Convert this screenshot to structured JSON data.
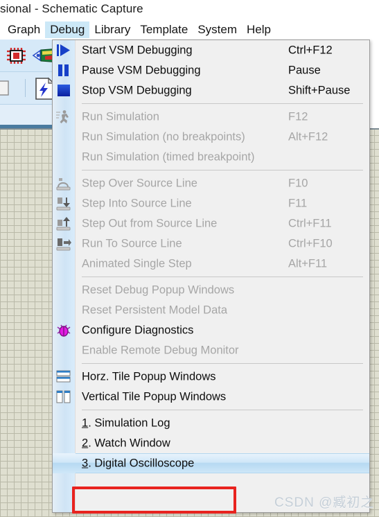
{
  "window": {
    "title": "sional - Schematic Capture"
  },
  "menubar": {
    "items": [
      {
        "label": "Graph",
        "active": false
      },
      {
        "label": "Debug",
        "active": true
      },
      {
        "label": "Library",
        "active": false
      },
      {
        "label": "Template",
        "active": false
      },
      {
        "label": "System",
        "active": false
      },
      {
        "label": "Help",
        "active": false
      }
    ]
  },
  "toolbar": {
    "icons": [
      {
        "name": "chip-icon"
      },
      {
        "name": "probe-icon"
      },
      {
        "name": "partial-icon"
      },
      {
        "name": "netlist-icon"
      }
    ]
  },
  "menu": {
    "name": "debug-menu",
    "items": [
      {
        "type": "item",
        "label": "Start VSM Debugging",
        "accel": "Ctrl+F12",
        "disabled": false,
        "icon": "play-icon",
        "mnemonic": ""
      },
      {
        "type": "item",
        "label": "Pause VSM Debugging",
        "accel": "Pause",
        "disabled": false,
        "icon": "pause-icon",
        "mnemonic": ""
      },
      {
        "type": "item",
        "label": "Stop VSM Debugging",
        "accel": "Shift+Pause",
        "disabled": false,
        "icon": "stop-icon",
        "mnemonic": ""
      },
      {
        "type": "separator"
      },
      {
        "type": "item",
        "label": "Run Simulation",
        "accel": "F12",
        "disabled": true,
        "icon": "run-icon",
        "mnemonic": ""
      },
      {
        "type": "item",
        "label": "Run Simulation (no breakpoints)",
        "accel": "Alt+F12",
        "disabled": true,
        "icon": "",
        "mnemonic": ""
      },
      {
        "type": "item",
        "label": "Run Simulation (timed breakpoint)",
        "accel": "",
        "disabled": true,
        "icon": "",
        "mnemonic": ""
      },
      {
        "type": "separator"
      },
      {
        "type": "item",
        "label": "Step Over Source Line",
        "accel": "F10",
        "disabled": true,
        "icon": "step-over-icon",
        "mnemonic": ""
      },
      {
        "type": "item",
        "label": "Step Into Source Line",
        "accel": "F11",
        "disabled": true,
        "icon": "step-into-icon",
        "mnemonic": ""
      },
      {
        "type": "item",
        "label": "Step Out from Source Line",
        "accel": "Ctrl+F11",
        "disabled": true,
        "icon": "step-out-icon",
        "mnemonic": ""
      },
      {
        "type": "item",
        "label": "Run To Source Line",
        "accel": "Ctrl+F10",
        "disabled": true,
        "icon": "run-to-icon",
        "mnemonic": ""
      },
      {
        "type": "item",
        "label": "Animated Single Step",
        "accel": "Alt+F11",
        "disabled": true,
        "icon": "",
        "mnemonic": ""
      },
      {
        "type": "separator"
      },
      {
        "type": "item",
        "label": "Reset Debug Popup Windows",
        "accel": "",
        "disabled": true,
        "icon": "",
        "mnemonic": ""
      },
      {
        "type": "item",
        "label": "Reset Persistent Model Data",
        "accel": "",
        "disabled": true,
        "icon": "",
        "mnemonic": ""
      },
      {
        "type": "item",
        "label": "Configure Diagnostics",
        "accel": "",
        "disabled": false,
        "icon": "bug-icon",
        "mnemonic": ""
      },
      {
        "type": "item",
        "label": "Enable Remote Debug Monitor",
        "accel": "",
        "disabled": true,
        "icon": "",
        "mnemonic": ""
      },
      {
        "type": "separator"
      },
      {
        "type": "item",
        "label": "Horz. Tile Popup Windows",
        "accel": "",
        "disabled": false,
        "icon": "tile-horz-icon",
        "mnemonic": ""
      },
      {
        "type": "item",
        "label": "Vertical Tile Popup Windows",
        "accel": "",
        "disabled": false,
        "icon": "tile-vert-icon",
        "mnemonic": ""
      },
      {
        "type": "separator"
      },
      {
        "type": "item",
        "label": ". Simulation Log",
        "accel": "",
        "disabled": false,
        "icon": "",
        "mnemonic": "1"
      },
      {
        "type": "item",
        "label": ". Watch Window",
        "accel": "",
        "disabled": false,
        "icon": "",
        "mnemonic": "2"
      },
      {
        "type": "item",
        "label": ". Digital Oscilloscope",
        "accel": "",
        "disabled": false,
        "icon": "",
        "mnemonic": "3",
        "highlighted": true
      }
    ]
  },
  "annotation": {
    "highlight_color": "#e8231f",
    "highlight_target": "3. Digital Oscilloscope"
  },
  "watermark": {
    "text": "CSDN @臧初之"
  }
}
